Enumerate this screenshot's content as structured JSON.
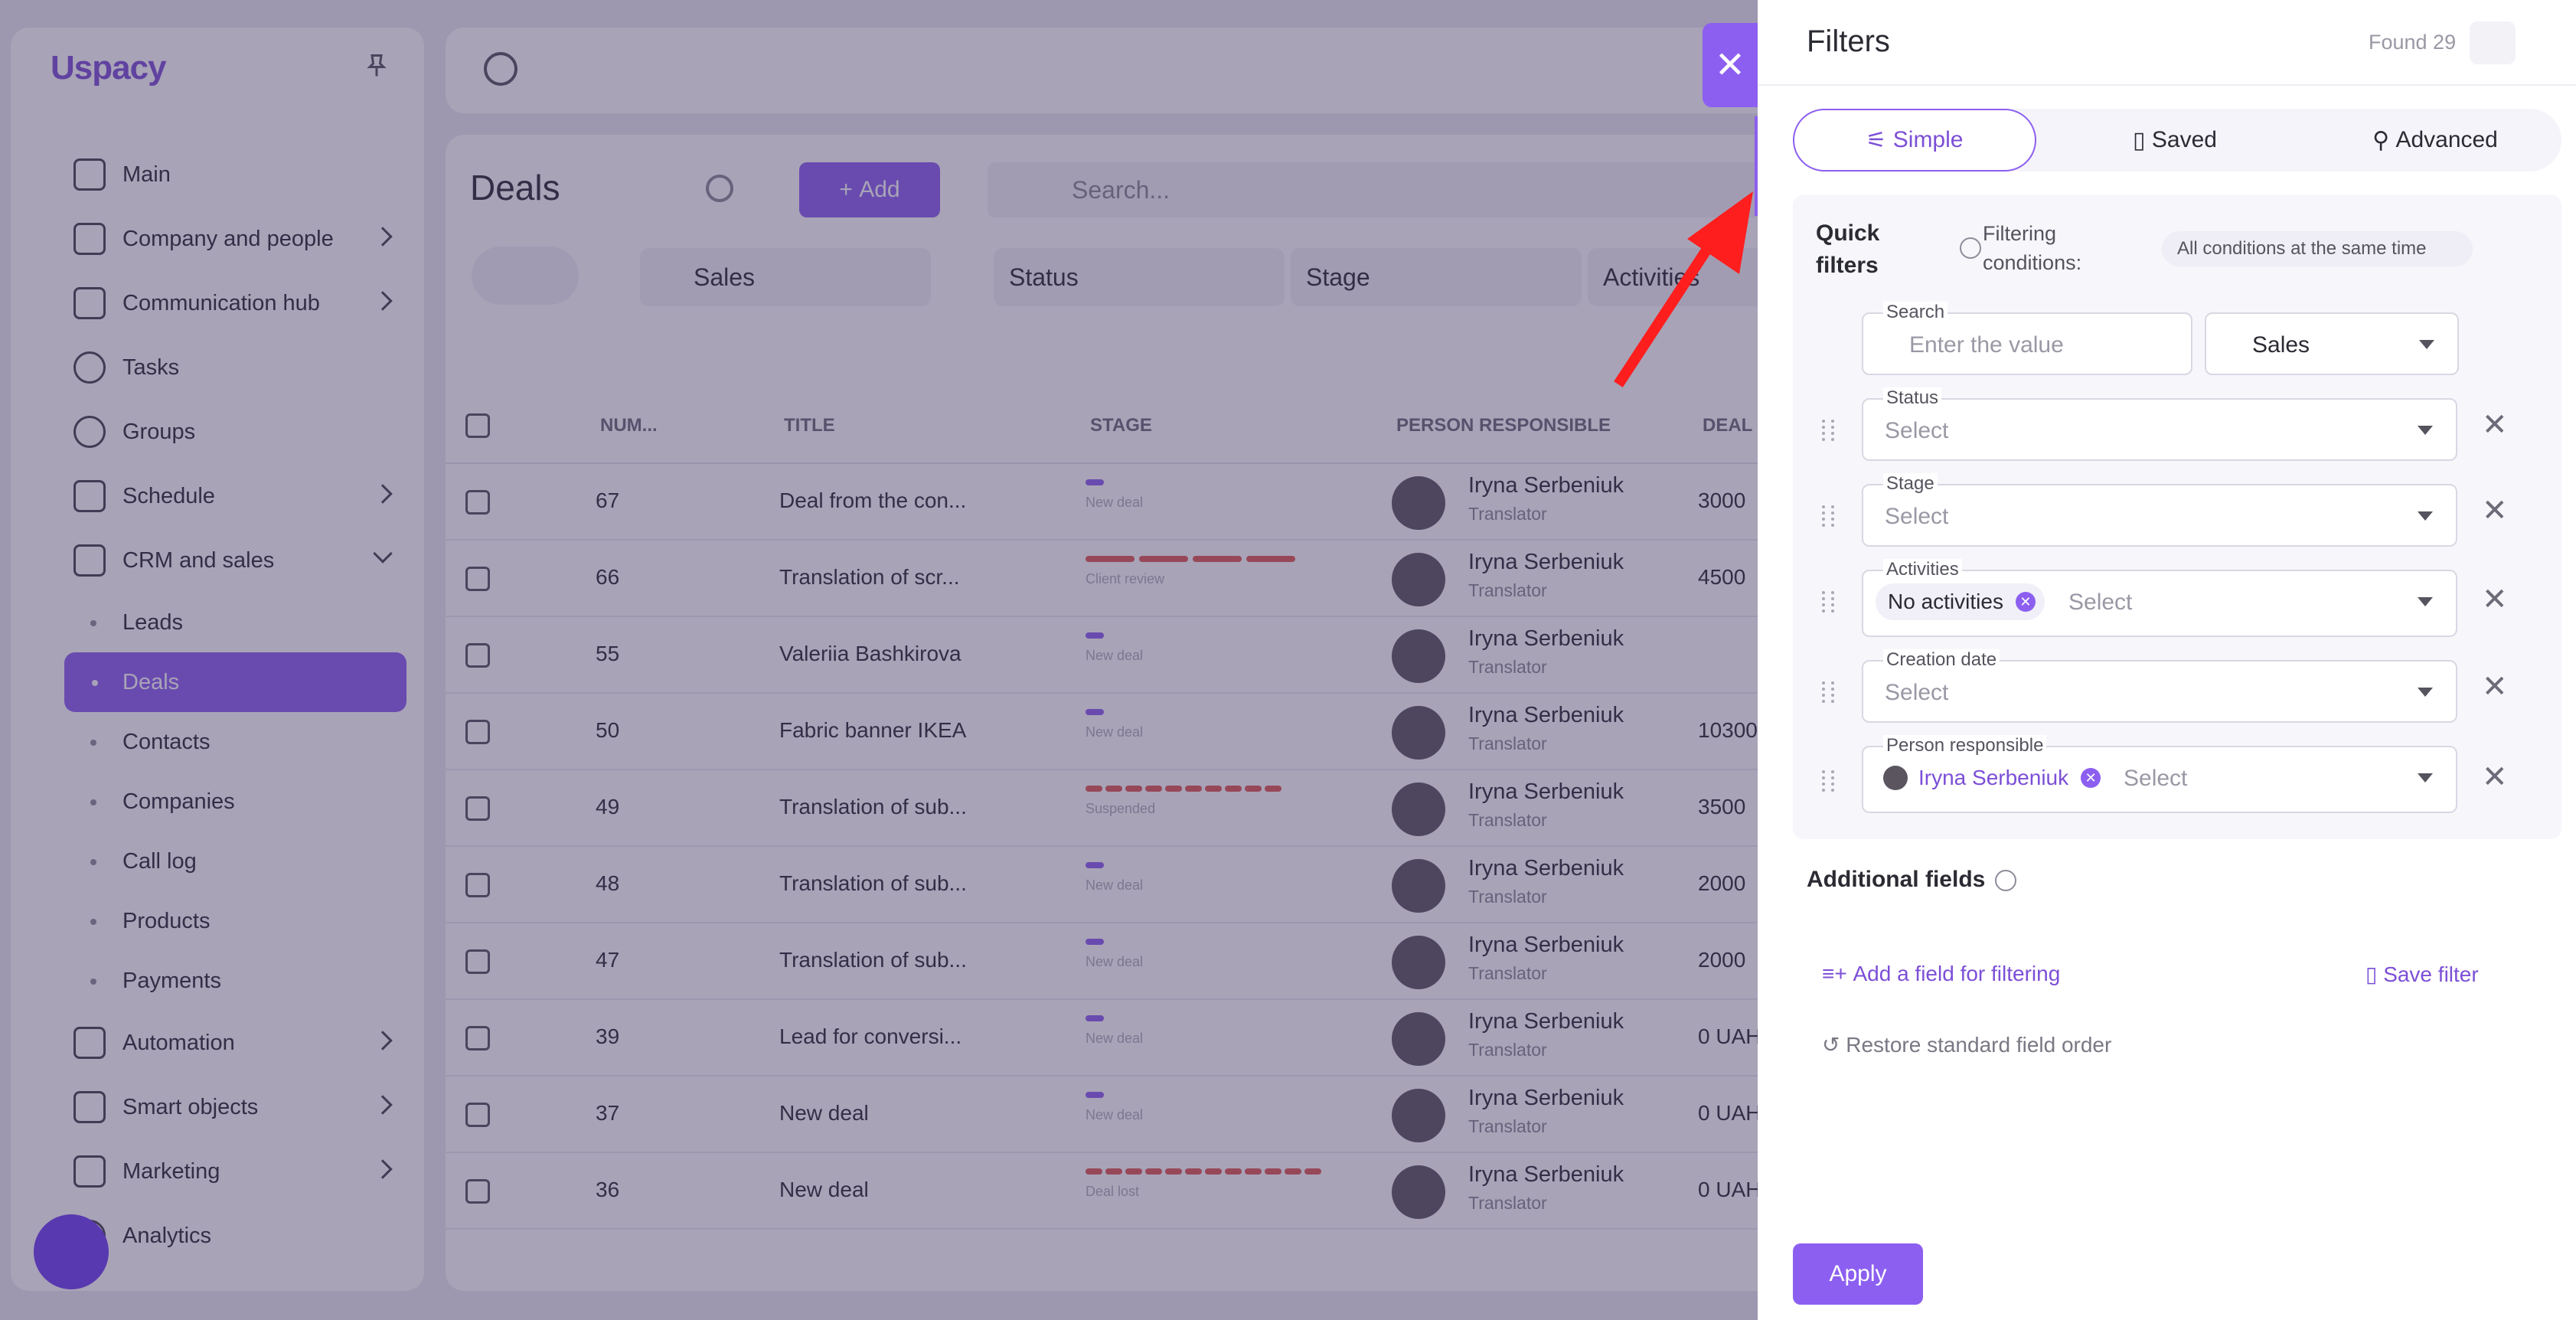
{
  "brand": {
    "logo": "Uspacy"
  },
  "sidebar": {
    "items": [
      {
        "label": "Main",
        "chevron": false
      },
      {
        "label": "Company and people",
        "chevron": true
      },
      {
        "label": "Communication hub",
        "chevron": true
      },
      {
        "label": "Tasks",
        "chevron": false
      },
      {
        "label": "Groups",
        "chevron": false
      },
      {
        "label": "Schedule",
        "chevron": true
      },
      {
        "label": "CRM and sales",
        "chevron": true
      }
    ],
    "crm_sub": [
      "Leads",
      "Deals",
      "Contacts",
      "Companies",
      "Call log",
      "Products",
      "Payments"
    ],
    "more_items": [
      {
        "label": "Automation"
      },
      {
        "label": "Smart objects"
      },
      {
        "label": "Marketing"
      },
      {
        "label": "Analytics"
      }
    ]
  },
  "page": {
    "title": "Deals",
    "add_label": "Add",
    "search_placeholder": "Search...",
    "pipeline_filter": "Sales",
    "status_filter": "Status",
    "stage_filter": "Stage",
    "activities_filter": "Activities"
  },
  "table": {
    "headers": [
      "NUM...",
      "TITLE",
      "STAGE",
      "PERSON RESPONSIBLE",
      "DEAL"
    ],
    "rows": [
      {
        "num": "67",
        "title": "Deal from the con...",
        "stage": "New deal",
        "stage_color": "#8c5ff0",
        "stage_segments": 1,
        "person": "Iryna Serbeniuk",
        "role": "Translator",
        "amount": "3000"
      },
      {
        "num": "66",
        "title": "Translation of scr...",
        "stage": "Client review",
        "stage_color": "#e05a52",
        "stage_segments": 4,
        "person": "Iryna Serbeniuk",
        "role": "Translator",
        "amount": "4500"
      },
      {
        "num": "55",
        "title": "Valeriia Bashkirova",
        "stage": "New deal",
        "stage_color": "#8c5ff0",
        "stage_segments": 1,
        "person": "Iryna Serbeniuk",
        "role": "Translator",
        "amount": ""
      },
      {
        "num": "50",
        "title": "Fabric banner IKEA",
        "stage": "New deal",
        "stage_color": "#8c5ff0",
        "stage_segments": 1,
        "person": "Iryna Serbeniuk",
        "role": "Translator",
        "amount": "10300"
      },
      {
        "num": "49",
        "title": "Translation of sub...",
        "stage": "Suspended",
        "stage_color": "#e05a52",
        "stage_segments": 10,
        "person": "Iryna Serbeniuk",
        "role": "Translator",
        "amount": "3500"
      },
      {
        "num": "48",
        "title": "Translation of sub...",
        "stage": "New deal",
        "stage_color": "#8c5ff0",
        "stage_segments": 1,
        "person": "Iryna Serbeniuk",
        "role": "Translator",
        "amount": "2000"
      },
      {
        "num": "47",
        "title": "Translation of sub...",
        "stage": "New deal",
        "stage_color": "#8c5ff0",
        "stage_segments": 1,
        "person": "Iryna Serbeniuk",
        "role": "Translator",
        "amount": "2000"
      },
      {
        "num": "39",
        "title": "Lead for conversi...",
        "stage": "New deal",
        "stage_color": "#8c5ff0",
        "stage_segments": 1,
        "person": "Iryna Serbeniuk",
        "role": "Translator",
        "amount": "0 UAH"
      },
      {
        "num": "37",
        "title": "New deal",
        "stage": "New deal",
        "stage_color": "#8c5ff0",
        "stage_segments": 1,
        "person": "Iryna Serbeniuk",
        "role": "Translator",
        "amount": "0 UAH"
      },
      {
        "num": "36",
        "title": "New deal",
        "stage": "Deal lost",
        "stage_color": "#e05a52",
        "stage_segments": 12,
        "person": "Iryna Serbeniuk",
        "role": "Translator",
        "amount": "0 UAH"
      }
    ]
  },
  "filters": {
    "title": "Filters",
    "found": "Found 29",
    "tabs": [
      "Simple",
      "Saved",
      "Advanced"
    ],
    "quick_title": "Quick filters",
    "conditions_label": "Filtering conditions:",
    "conditions_value": "All conditions at the same time",
    "search_label": "Search",
    "search_placeholder": "Enter the value",
    "pipeline": "Sales",
    "fields": [
      {
        "label": "Status",
        "value": "Select"
      },
      {
        "label": "Stage",
        "value": "Select"
      },
      {
        "label": "Activities",
        "chip": "No activities",
        "value": "Select"
      },
      {
        "label": "Creation date",
        "value": "Select"
      },
      {
        "label": "Person responsible",
        "chip": "Iryna Serbeniuk",
        "value": "Select"
      }
    ],
    "additional": "Additional fields",
    "add_field": "Add a field for filtering",
    "save_filter": "Save filter",
    "restore": "Restore standard field order",
    "apply": "Apply"
  },
  "colors": {
    "accent": "#8c5ff0",
    "arrow": "#ff1e1e",
    "danger": "#e05a52"
  }
}
